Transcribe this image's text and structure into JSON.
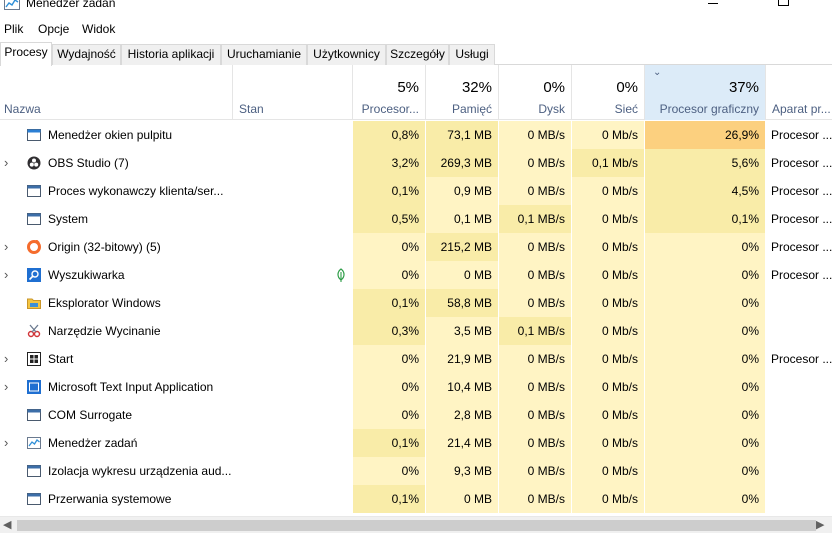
{
  "window": {
    "title": "Menedżer zadań"
  },
  "menu": [
    "Plik",
    "Opcje",
    "Widok"
  ],
  "tabs": [
    "Procesy",
    "Wydajność",
    "Historia aplikacji",
    "Uruchamianie",
    "Użytkownicy",
    "Szczegóły",
    "Usługi"
  ],
  "active_tab": "Procesy",
  "columns": {
    "name": "Nazwa",
    "status": "Stan",
    "cpu": {
      "label": "Procesor...",
      "pct": "5%"
    },
    "memory": {
      "label": "Pamięć",
      "pct": "32%"
    },
    "disk": {
      "label": "Dysk",
      "pct": "0%"
    },
    "network": {
      "label": "Sieć",
      "pct": "0%"
    },
    "gpu": {
      "label": "Procesor graficzny",
      "pct": "37%"
    },
    "gpu_engine": "Aparat pr..."
  },
  "processes": [
    {
      "name": "Menedżer okien pulpitu",
      "expandable": false,
      "icon": "desktop-window-manager-icon",
      "status_leaf": false,
      "cpu": "0,8%",
      "memory": "73,1 MB",
      "disk": "0 MB/s",
      "network": "0 Mb/s",
      "gpu": "26,9%",
      "gpu_engine": "Procesor ...",
      "cpu_level": 2,
      "mem_level": 2,
      "gpu_level": 4
    },
    {
      "name": "OBS Studio (7)",
      "expandable": true,
      "icon": "obs-studio-icon",
      "status_leaf": false,
      "cpu": "3,2%",
      "memory": "269,3 MB",
      "disk": "0 MB/s",
      "network": "0,1 Mb/s",
      "gpu": "5,6%",
      "gpu_engine": "Procesor ...",
      "cpu_level": 2,
      "mem_level": 2,
      "gpu_level": 2,
      "net_level": 2
    },
    {
      "name": "Proces wykonawczy klienta/ser...",
      "expandable": false,
      "icon": "system-process-icon",
      "status_leaf": false,
      "cpu": "0,1%",
      "memory": "0,9 MB",
      "disk": "0 MB/s",
      "network": "0 Mb/s",
      "gpu": "4,5%",
      "gpu_engine": "Procesor ...",
      "cpu_level": 2,
      "mem_level": 1,
      "gpu_level": 2
    },
    {
      "name": "System",
      "expandable": false,
      "icon": "system-process-icon",
      "status_leaf": false,
      "cpu": "0,5%",
      "memory": "0,1 MB",
      "disk": "0,1 MB/s",
      "network": "0 Mb/s",
      "gpu": "0,1%",
      "gpu_engine": "Procesor ...",
      "cpu_level": 2,
      "mem_level": 1,
      "gpu_level": 2,
      "disk_level": 2
    },
    {
      "name": "Origin (32-bitowy) (5)",
      "expandable": true,
      "icon": "origin-icon",
      "status_leaf": false,
      "cpu": "0%",
      "memory": "215,2 MB",
      "disk": "0 MB/s",
      "network": "0 Mb/s",
      "gpu": "0%",
      "gpu_engine": "Procesor ...",
      "cpu_level": 1,
      "mem_level": 2,
      "gpu_level": 1
    },
    {
      "name": "Wyszukiwarka",
      "expandable": true,
      "icon": "search-app-icon",
      "status_leaf": true,
      "cpu": "0%",
      "memory": "0 MB",
      "disk": "0 MB/s",
      "network": "0 Mb/s",
      "gpu": "0%",
      "gpu_engine": "Procesor ...",
      "cpu_level": 1,
      "mem_level": 1,
      "gpu_level": 1
    },
    {
      "name": "Eksplorator Windows",
      "expandable": false,
      "icon": "file-explorer-icon",
      "status_leaf": false,
      "cpu": "0,1%",
      "memory": "58,8 MB",
      "disk": "0 MB/s",
      "network": "0 Mb/s",
      "gpu": "0%",
      "gpu_engine": "",
      "cpu_level": 2,
      "mem_level": 2,
      "gpu_level": 1
    },
    {
      "name": "Narzędzie Wycinanie",
      "expandable": false,
      "icon": "snipping-tool-icon",
      "status_leaf": false,
      "cpu": "0,3%",
      "memory": "3,5 MB",
      "disk": "0,1 MB/s",
      "network": "0 Mb/s",
      "gpu": "0%",
      "gpu_engine": "",
      "cpu_level": 2,
      "mem_level": 1,
      "gpu_level": 1,
      "disk_level": 2
    },
    {
      "name": "Start",
      "expandable": true,
      "icon": "start-app-icon",
      "status_leaf": false,
      "cpu": "0%",
      "memory": "21,9 MB",
      "disk": "0 MB/s",
      "network": "0 Mb/s",
      "gpu": "0%",
      "gpu_engine": "Procesor ...",
      "cpu_level": 1,
      "mem_level": 1,
      "gpu_level": 1
    },
    {
      "name": "Microsoft Text Input Application",
      "expandable": true,
      "icon": "text-input-icon",
      "status_leaf": false,
      "cpu": "0%",
      "memory": "10,4 MB",
      "disk": "0 MB/s",
      "network": "0 Mb/s",
      "gpu": "0%",
      "gpu_engine": "",
      "cpu_level": 1,
      "mem_level": 1,
      "gpu_level": 1
    },
    {
      "name": "COM Surrogate",
      "expandable": false,
      "icon": "system-process-icon",
      "status_leaf": false,
      "cpu": "0%",
      "memory": "2,8 MB",
      "disk": "0 MB/s",
      "network": "0 Mb/s",
      "gpu": "0%",
      "gpu_engine": "",
      "cpu_level": 1,
      "mem_level": 1,
      "gpu_level": 1
    },
    {
      "name": "Menedżer zadań",
      "expandable": true,
      "icon": "task-manager-icon",
      "status_leaf": false,
      "cpu": "0,1%",
      "memory": "21,4 MB",
      "disk": "0 MB/s",
      "network": "0 Mb/s",
      "gpu": "0%",
      "gpu_engine": "",
      "cpu_level": 2,
      "mem_level": 1,
      "gpu_level": 1
    },
    {
      "name": "Izolacja wykresu urządzenia aud...",
      "expandable": false,
      "icon": "system-process-icon",
      "status_leaf": false,
      "cpu": "0%",
      "memory": "9,3 MB",
      "disk": "0 MB/s",
      "network": "0 Mb/s",
      "gpu": "0%",
      "gpu_engine": "",
      "cpu_level": 1,
      "mem_level": 1,
      "gpu_level": 1
    },
    {
      "name": "Przerwania systemowe",
      "expandable": false,
      "icon": "system-process-icon",
      "status_leaf": false,
      "cpu": "0,1%",
      "memory": "0 MB",
      "disk": "0 MB/s",
      "network": "0 Mb/s",
      "gpu": "0%",
      "gpu_engine": "",
      "cpu_level": 2,
      "mem_level": 1,
      "gpu_level": 1
    }
  ],
  "colors": {
    "heat_1": "#fff4c4",
    "heat_2": "#f9eca8",
    "heat_3": "#fde08a",
    "heat_4": "#fcd07f",
    "sorted_header": "#dcebf8",
    "header_label": "#4d6082"
  }
}
